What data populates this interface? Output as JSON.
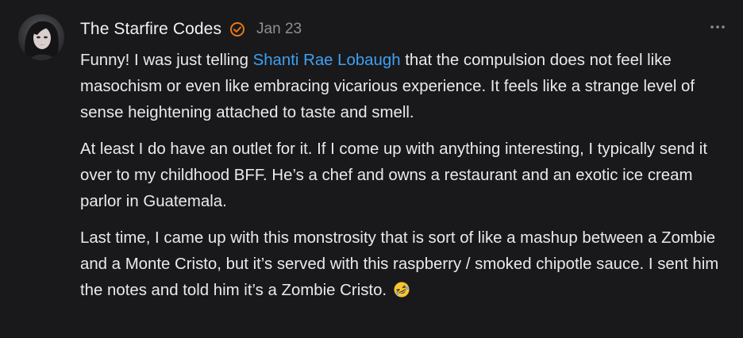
{
  "comment": {
    "author": "The Starfire Codes",
    "date": "Jan 23",
    "badge_icon": "verified-check-icon",
    "more_icon": "more-horizontal-icon",
    "accent_color": "#e8761a",
    "mention_color": "#3fa0f2",
    "paragraph1": {
      "before": "Funny! I was just telling ",
      "mention": "Shanti Rae Lobaugh",
      "after": " that the compulsion does not feel like masochism or even like embracing vicarious experience. It feels like a strange level of sense heightening attached to taste and smell."
    },
    "paragraph2": "At least I do have an outlet for it. If I come up with anything interesting, I typically send it over to my childhood BFF. He’s a chef and owns a restaurant and an exotic ice cream parlor in Guatemala.",
    "paragraph3": "Last time, I came up with this monstrosity that is sort of like a mashup between a Zombie and a Monte Cristo, but it’s served with this raspberry / smoked chipotle sauce. I sent him the notes and told him it’s a Zombie Cristo.",
    "emoji": "rolling-on-floor-laughing-emoji"
  }
}
